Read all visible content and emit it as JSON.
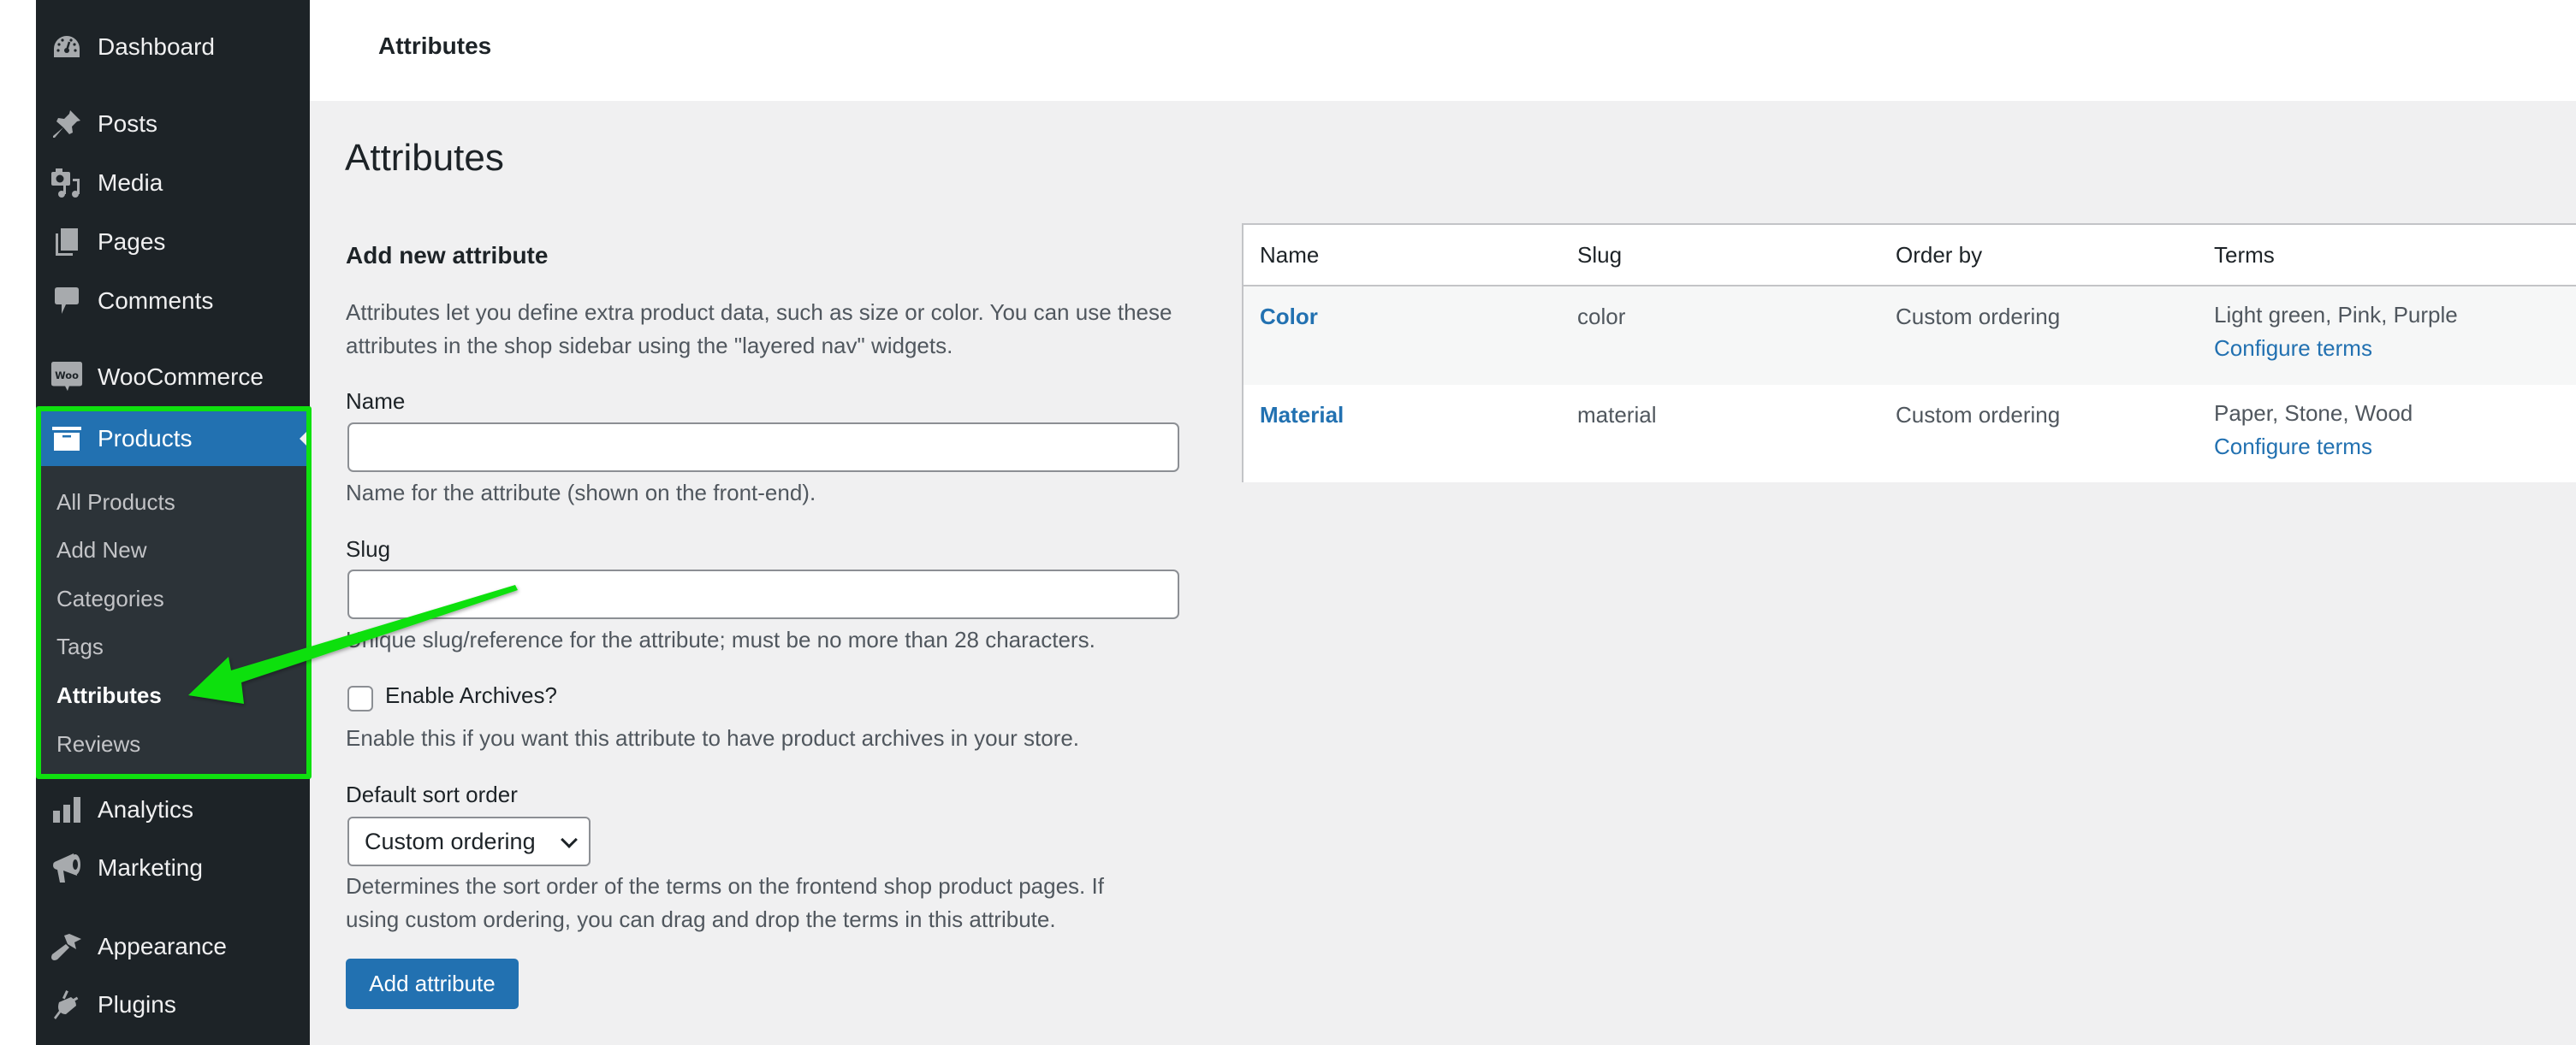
{
  "sidebar": {
    "items": [
      {
        "label": "Dashboard",
        "icon": "dashboard-icon"
      },
      {
        "label": "Posts",
        "icon": "pin-icon"
      },
      {
        "label": "Media",
        "icon": "media-icon"
      },
      {
        "label": "Pages",
        "icon": "pages-icon"
      },
      {
        "label": "Comments",
        "icon": "comment-icon"
      },
      {
        "label": "WooCommerce",
        "icon": "woo-icon"
      },
      {
        "label": "Products",
        "icon": "archive-box-icon",
        "active": true
      },
      {
        "label": "Analytics",
        "icon": "bar-chart-icon"
      },
      {
        "label": "Marketing",
        "icon": "megaphone-icon"
      },
      {
        "label": "Appearance",
        "icon": "paintbrush-icon"
      },
      {
        "label": "Plugins",
        "icon": "plug-icon"
      }
    ],
    "products_submenu": [
      {
        "label": "All Products"
      },
      {
        "label": "Add New"
      },
      {
        "label": "Categories"
      },
      {
        "label": "Tags"
      },
      {
        "label": "Attributes",
        "current": true
      },
      {
        "label": "Reviews"
      }
    ],
    "woo_badge": "Woo"
  },
  "header": {
    "title": "Attributes"
  },
  "page": {
    "title": "Attributes"
  },
  "form": {
    "section_title": "Add new attribute",
    "description": "Attributes let you define extra product data, such as size or color. You can use these attributes in the shop sidebar using the \"layered nav\" widgets.",
    "name": {
      "label": "Name",
      "value": "",
      "hint": "Name for the attribute (shown on the front-end)."
    },
    "slug": {
      "label": "Slug",
      "value": "",
      "hint": "Unique slug/reference for the attribute; must be no more than 28 characters."
    },
    "archives": {
      "label": "Enable Archives?",
      "checked": false,
      "hint": "Enable this if you want this attribute to have product archives in your store."
    },
    "sort": {
      "label": "Default sort order",
      "selected": "Custom ordering",
      "hint_line1": "Determines the sort order of the terms on the frontend shop product pages. If",
      "hint_line2": "using custom ordering, you can drag and drop the terms in this attribute."
    },
    "submit_label": "Add attribute"
  },
  "table": {
    "columns": [
      "Name",
      "Slug",
      "Order by",
      "Terms"
    ],
    "rows": [
      {
        "name": "Color",
        "slug": "color",
        "order_by": "Custom ordering",
        "terms": "Light green, Pink, Purple",
        "action": "Configure terms"
      },
      {
        "name": "Material",
        "slug": "material",
        "order_by": "Custom ordering",
        "terms": "Paper, Stone, Wood",
        "action": "Configure terms"
      }
    ]
  },
  "colors": {
    "sidebar_bg": "#1d2327",
    "submenu_bg": "#2c3338",
    "accent": "#2271b1",
    "annotation": "#0fe00f",
    "content_bg": "#f0f0f1"
  }
}
